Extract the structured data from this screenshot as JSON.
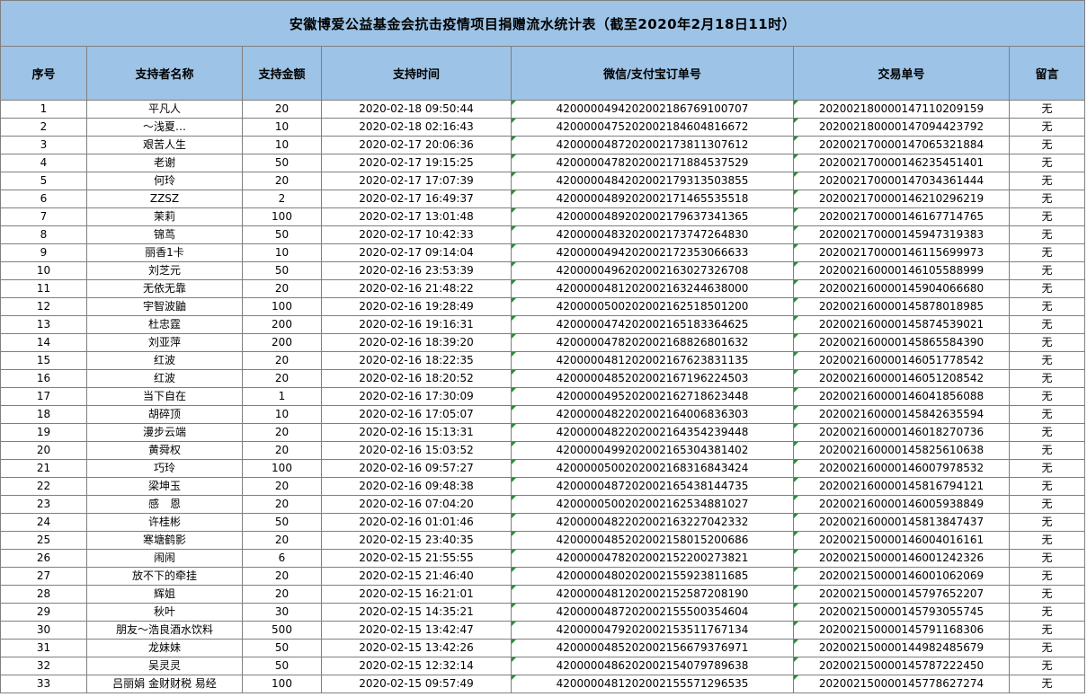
{
  "title": "安徽博爱公益基金会抗击疫情项目捐赠流水统计表（截至2020年2月18日11时）",
  "headers": [
    "序号",
    "支持者名称",
    "支持金额",
    "支持时间",
    "微信/支付宝订单号",
    "交易单号",
    "留言"
  ],
  "rows": [
    [
      "1",
      "平凡人",
      "20",
      "2020-02-18 09:50:44",
      "4200000494202002186769100707",
      "2020021800001471102​09159",
      "无"
    ],
    [
      "2",
      "～浅夏…",
      "10",
      "2020-02-18 02:16:43",
      "4200000475202002184604816672",
      "202002180000147094423792",
      "无"
    ],
    [
      "3",
      "艰苦人生",
      "10",
      "2020-02-17 20:06:36",
      "4200000487202002173811307612",
      "202002170000147065321884",
      "无"
    ],
    [
      "4",
      "老谢",
      "50",
      "2020-02-17 19:15:25",
      "4200000478202002171884537529",
      "202002170000146235451401",
      "无"
    ],
    [
      "5",
      "何玲",
      "20",
      "2020-02-17 17:07:39",
      "4200000484202002179313503855",
      "202002170000147034361444",
      "无"
    ],
    [
      "6",
      "ZZSZ",
      "2",
      "2020-02-17 16:49:37",
      "4200000489202002171465535518",
      "202002170000146210296219",
      "无"
    ],
    [
      "7",
      "茉莉",
      "100",
      "2020-02-17 13:01:48",
      "4200000489202002179637341365",
      "202002170000146167714765",
      "无"
    ],
    [
      "8",
      "锦茑",
      "50",
      "2020-02-17 10:42:33",
      "4200000483202002173747264830",
      "202002170000145947319383",
      "无"
    ],
    [
      "9",
      "丽香1卡",
      "10",
      "2020-02-17 09:14:04",
      "4200000494202002172353066633",
      "202002170000146115699973",
      "无"
    ],
    [
      "10",
      "刘芝元",
      "50",
      "2020-02-16 23:53:39",
      "4200000496202002163027326708",
      "202002160000146105588999",
      "无"
    ],
    [
      "11",
      "无依无靠",
      "20",
      "2020-02-16 21:48:22",
      "4200000481202002163244638000",
      "202002160000145904066680",
      "无"
    ],
    [
      "12",
      "宇智波鼬",
      "100",
      "2020-02-16 19:28:49",
      "4200000500202002162518501200",
      "202002160000145878018985",
      "无"
    ],
    [
      "13",
      "杜忠霆",
      "200",
      "2020-02-16 19:16:31",
      "4200000474202002165183364625",
      "202002160000145874539021",
      "无"
    ],
    [
      "14",
      "刘亚萍",
      "200",
      "2020-02-16 18:39:20",
      "4200000478202002168826801632",
      "202002160000145865584390",
      "无"
    ],
    [
      "15",
      "红波",
      "20",
      "2020-02-16 18:22:35",
      "4200000481202002167623831135",
      "202002160000146051778542",
      "无"
    ],
    [
      "16",
      "红波",
      "20",
      "2020-02-16 18:20:52",
      "4200000485202002167196224503",
      "202002160000146051208542",
      "无"
    ],
    [
      "17",
      "当下自在",
      "1",
      "2020-02-16 17:30:09",
      "4200000495202002162718623448",
      "202002160000146041856088",
      "无"
    ],
    [
      "18",
      "胡碎顶",
      "10",
      "2020-02-16 17:05:07",
      "4200000482202002164006836303",
      "202002160000145842635594",
      "无"
    ],
    [
      "19",
      "漫步云端",
      "20",
      "2020-02-16 15:13:31",
      "4200000482202002164354239448",
      "202002160000146018270736",
      "无"
    ],
    [
      "20",
      "黄舜权",
      "20",
      "2020-02-16 15:03:52",
      "4200000499202002165304381402",
      "202002160000145825610638",
      "无"
    ],
    [
      "21",
      "巧玲",
      "100",
      "2020-02-16 09:57:27",
      "4200000500202002168316843424",
      "202002160000146007978532",
      "无"
    ],
    [
      "22",
      "梁坤玉",
      "20",
      "2020-02-16 09:48:38",
      "4200000487202002165438144735",
      "202002160000145816794121",
      "无"
    ],
    [
      "23",
      "感　恩",
      "20",
      "2020-02-16 07:04:20",
      "4200000500202002162534881027",
      "202002160000146005938849",
      "无"
    ],
    [
      "24",
      "许桂彬",
      "50",
      "2020-02-16 01:01:46",
      "4200000482202002163227042332",
      "202002160000145813847437",
      "无"
    ],
    [
      "25",
      "寒塘鹤影",
      "20",
      "2020-02-15 23:40:35",
      "4200000485202002158015200686",
      "202002150000146004016161",
      "无"
    ],
    [
      "26",
      "闹闹",
      "6",
      "2020-02-15 21:55:55",
      "4200000478202002152200273821",
      "202002150000146001242326",
      "无"
    ],
    [
      "27",
      "放不下的牵挂",
      "20",
      "2020-02-15 21:46:40",
      "4200000480202002155923811685",
      "202002150000146001062069",
      "无"
    ],
    [
      "28",
      "辉姐",
      "20",
      "2020-02-15 16:21:01",
      "4200000481202002152587208190",
      "202002150000145797652207",
      "无"
    ],
    [
      "29",
      "秋叶",
      "30",
      "2020-02-15 14:35:21",
      "4200000487202002155500354604",
      "202002150000145793055745",
      "无"
    ],
    [
      "30",
      "朋友～浩良酒水饮料",
      "500",
      "2020-02-15 13:42:47",
      "4200000479202002153511767134",
      "202002150000145791168306",
      "无"
    ],
    [
      "31",
      "龙妹妹",
      "50",
      "2020-02-15 13:42:26",
      "4200000485202002156679376971",
      "202002150000144982485679",
      "无"
    ],
    [
      "32",
      "吴灵灵",
      "50",
      "2020-02-15 12:32:14",
      "4200000486202002154079789638",
      "202002150000145787222450",
      "无"
    ],
    [
      "33",
      "吕丽娟 金财财税 易经",
      "100",
      "2020-02-15 09:57:49",
      "4200000481202002155571296535",
      "202002150000145778627274",
      "无"
    ]
  ]
}
